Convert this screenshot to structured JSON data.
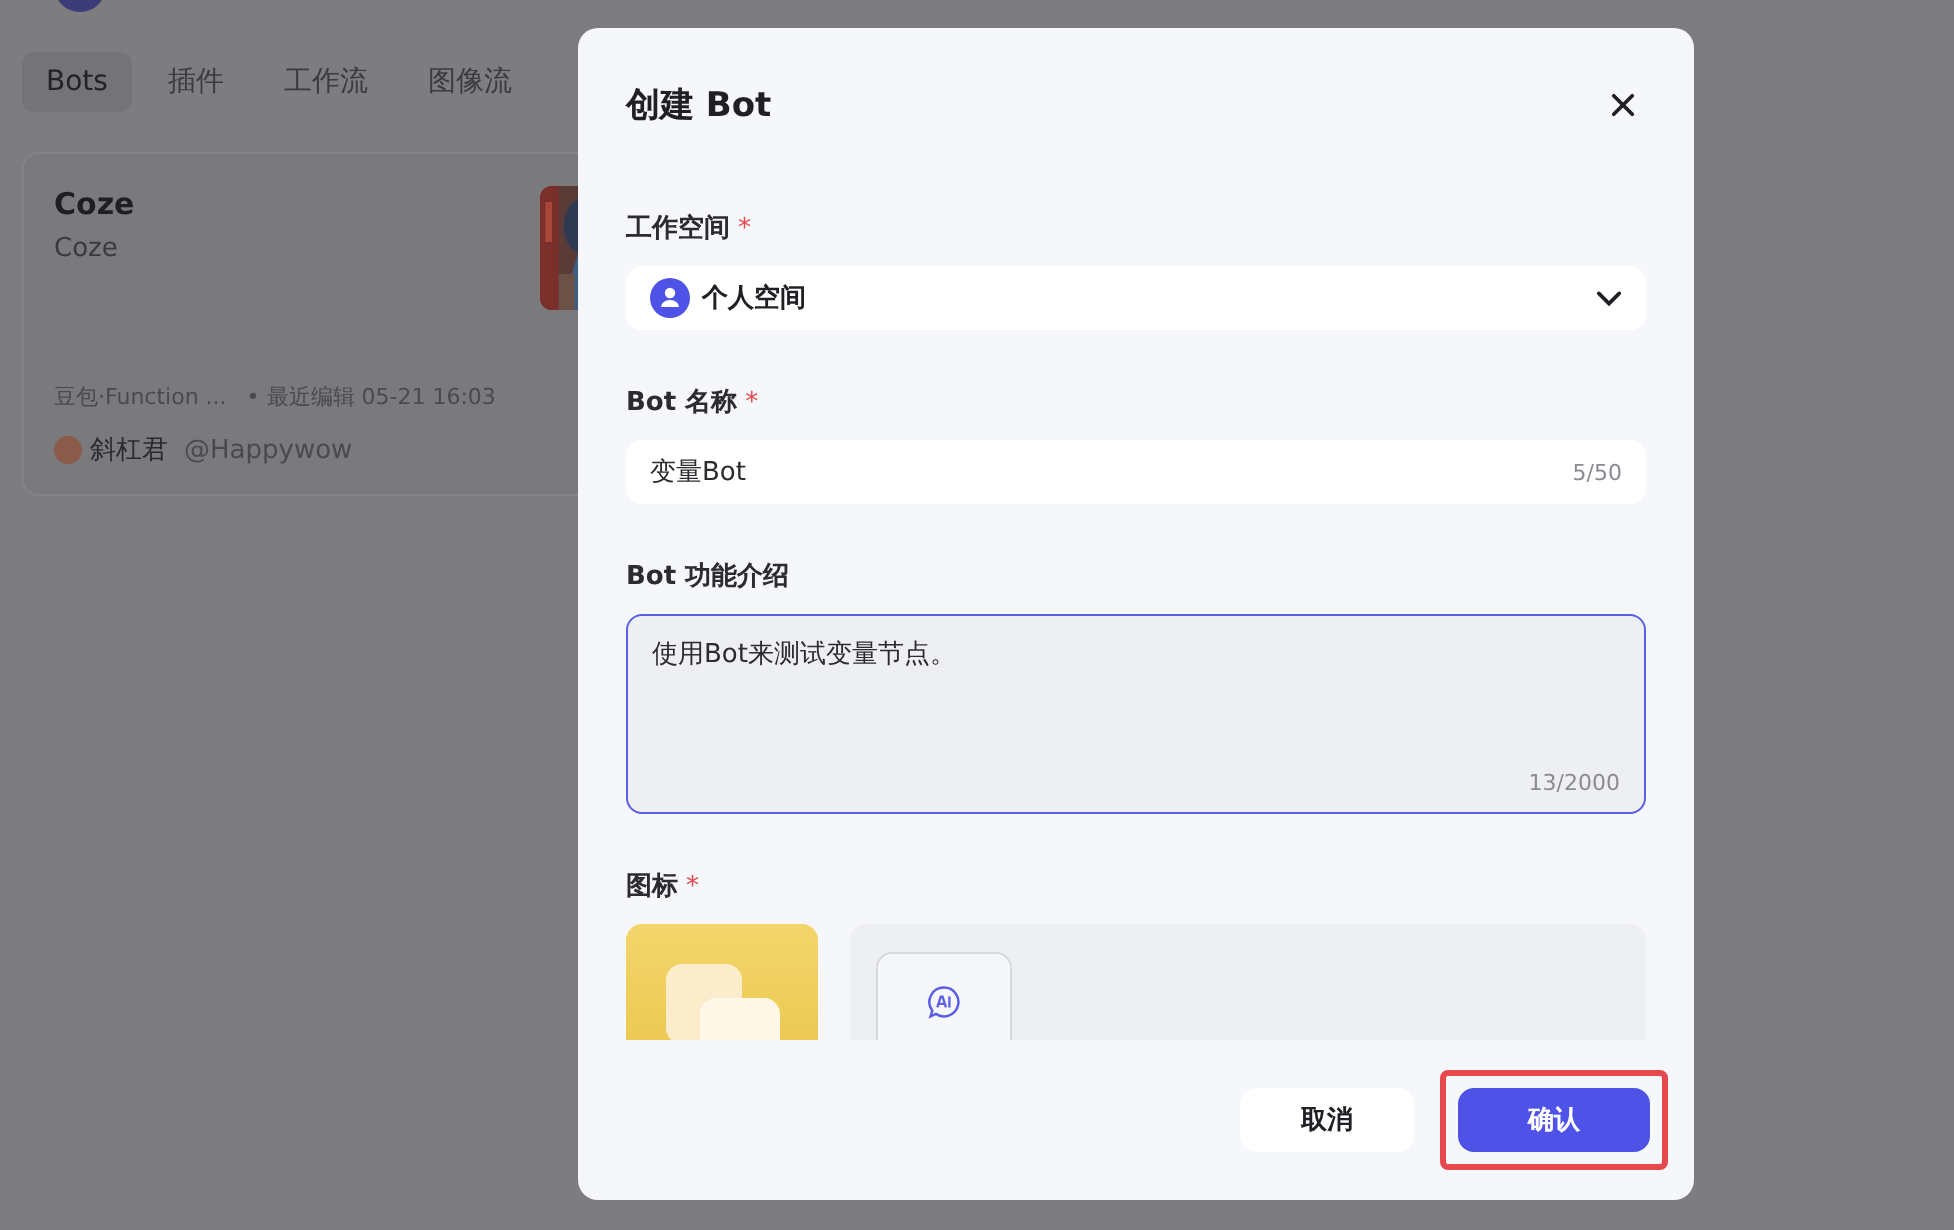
{
  "background": {
    "tabs": [
      {
        "label": "Bots",
        "selected": true
      },
      {
        "label": "插件",
        "selected": false
      },
      {
        "label": "工作流",
        "selected": false
      },
      {
        "label": "图像流",
        "selected": false
      }
    ],
    "bot_card": {
      "name": "Coze",
      "description": "Coze",
      "model": "豆包·Function ...",
      "edited": "• 最近编辑 05-21 16:03",
      "author": "斜杠君",
      "handle": "@Happywow"
    }
  },
  "dialog": {
    "title": "创建 Bot",
    "fields": [
      {
        "kind": "select",
        "label": "工作空间",
        "required_mark": "*",
        "value": "个人空间"
      },
      {
        "kind": "text",
        "label": "Bot 名称",
        "required_mark": "*",
        "value": "变量Bot",
        "counter": "5/50"
      },
      {
        "kind": "textarea",
        "label": "Bot 功能介绍",
        "value": "使用Bot来测试变量节点。",
        "counter": "13/2000",
        "focused": true
      },
      {
        "kind": "icon",
        "label": "图标",
        "required_mark": "*"
      }
    ],
    "buttons": [
      {
        "label": "取消",
        "primary": false,
        "highlighted": false
      },
      {
        "label": "确认",
        "primary": true,
        "highlighted": true
      }
    ]
  }
}
